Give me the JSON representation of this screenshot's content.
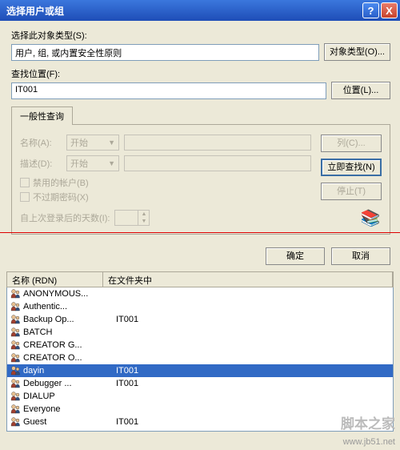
{
  "titlebar": {
    "title": "选择用户或组",
    "help": "?",
    "close": "X"
  },
  "section1": {
    "label": "选择此对象类型(S):",
    "value": "用户, 组, 或内置安全性原则",
    "btn": "对象类型(O)..."
  },
  "section2": {
    "label": "查找位置(F):",
    "value": "IT001",
    "btn": "位置(L)..."
  },
  "tab": "一般性查询",
  "form": {
    "name_label": "名称(A):",
    "desc_label": "描述(D):",
    "combo": "开始",
    "chk1": "禁用的帐户(B)",
    "chk2": "不过期密码(X)",
    "spin_label": "自上次登录后的天数(I):"
  },
  "side": {
    "columns": "列(C)...",
    "findnow": "立即查找(N)",
    "stop": "停止(T)"
  },
  "dlg": {
    "ok": "确定",
    "cancel": "取消"
  },
  "list": {
    "col1": "名称 (RDN)",
    "col2": "在文件夹中",
    "rows": [
      {
        "rdn": "ANONYMOUS...",
        "loc": ""
      },
      {
        "rdn": "Authentic...",
        "loc": ""
      },
      {
        "rdn": "Backup Op...",
        "loc": "IT001"
      },
      {
        "rdn": "BATCH",
        "loc": ""
      },
      {
        "rdn": "CREATOR G...",
        "loc": ""
      },
      {
        "rdn": "CREATOR O...",
        "loc": ""
      },
      {
        "rdn": "dayin",
        "loc": "IT001",
        "sel": true
      },
      {
        "rdn": "Debugger ...",
        "loc": "IT001"
      },
      {
        "rdn": "DIALUP",
        "loc": ""
      },
      {
        "rdn": "Everyone",
        "loc": ""
      },
      {
        "rdn": "Guest",
        "loc": "IT001"
      }
    ]
  },
  "watermark": "www.jb51.net",
  "watermark2": "脚本之家"
}
